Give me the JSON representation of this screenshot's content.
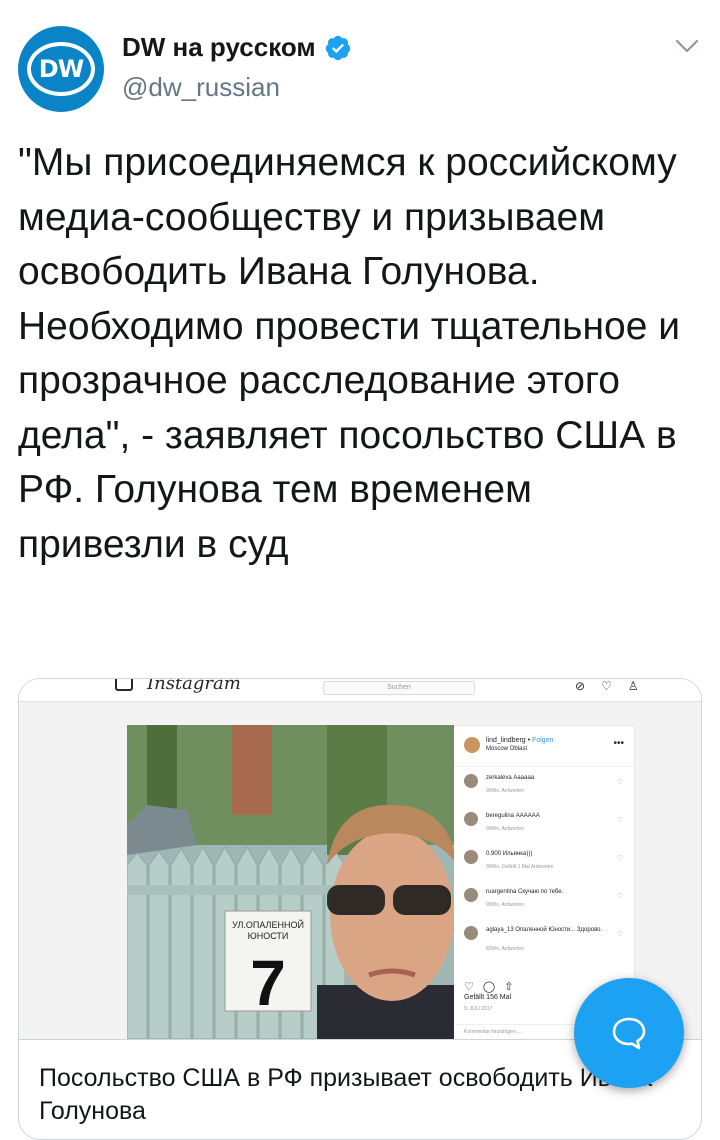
{
  "header": {
    "avatar_text": "DW",
    "display_name": "DW на русском",
    "handle": "@dw_russian"
  },
  "tweet": {
    "text": "\"Мы присоединяемся к российскому медиа-сообществу и призываем освободить Ивана Голунова. Необходимо провести тщательное и прозрачное расследование этого дела\", - заявляет посольство США в РФ. Голунова тем временем привезли в суд"
  },
  "card": {
    "title": "Посольство США в РФ призывает освободить Ивана Голунова",
    "image": {
      "instagram_logo": "Instagram",
      "search_placeholder": "Suchen",
      "sign_line1": "УЛ.ОПАЛЕННОЙ",
      "sign_line2": "ЮНОСТИ",
      "house_number": "7",
      "post_user": "lind_lindberg",
      "follow": "Folgen",
      "location": "Moscow Oblast",
      "comments": [
        {
          "user": "zerkaleva",
          "text": "Аааааа",
          "meta": "99Wo.   Antworten"
        },
        {
          "user": "beregulina",
          "text": "АААААА",
          "meta": "99Wo.   Antworten"
        },
        {
          "user": "0.900",
          "text": "Ильинка)))",
          "meta": "99Wo.   Gefällt 1 Mal   Antworten"
        },
        {
          "user": "ruargentina",
          "text": "Скучаю по тебе.",
          "meta": "99Wo.   Antworten"
        },
        {
          "user": "aglaya_13",
          "text": "Опаленной Юности... Здорово.",
          "meta": "83Wo.   Antworten"
        }
      ],
      "likes": "Gefällt 156 Mal",
      "date": "9. JULI 2017",
      "add_comment": "Kommentar hinzufügen ..."
    }
  },
  "colors": {
    "accent": "#1da1f2",
    "dw_blue": "#0a84c7",
    "text": "#14171a",
    "secondary": "#657786"
  },
  "icons": [
    "verified-badge-icon",
    "chevron-down-icon",
    "compose-icon"
  ]
}
